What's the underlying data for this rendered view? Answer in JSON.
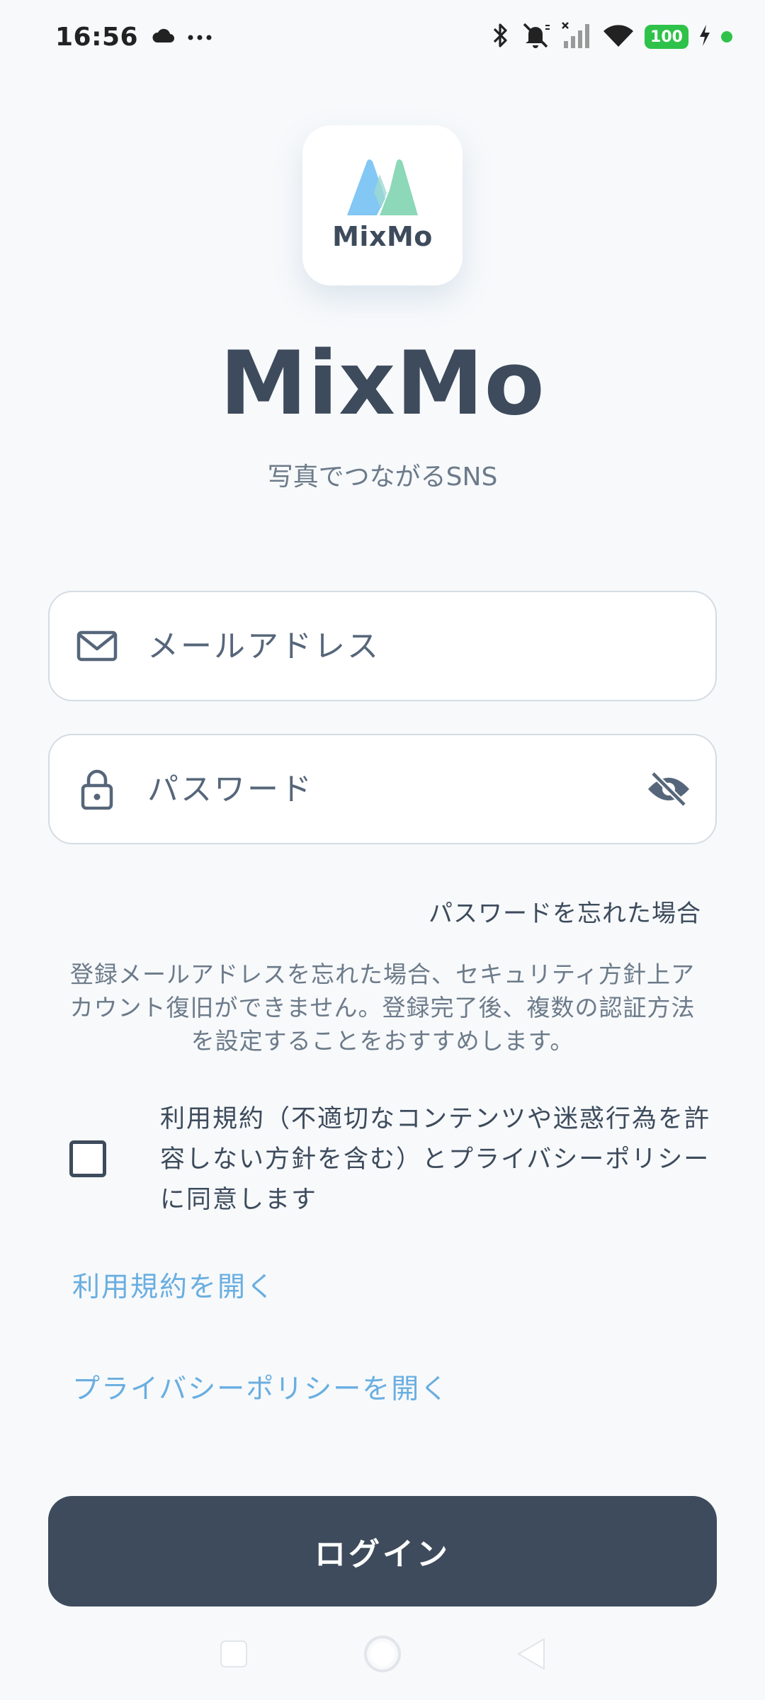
{
  "status_bar": {
    "time": "16:56",
    "battery": "100",
    "icons": [
      "cloud-icon",
      "more-icon",
      "bluetooth-icon",
      "bell-off-icon",
      "signal-icon",
      "wifi-icon",
      "battery-icon",
      "charging-icon"
    ]
  },
  "app": {
    "logo_text": "MixMo",
    "title": "MixMo",
    "subtitle": "写真でつながるSNS"
  },
  "form": {
    "email_placeholder": "メールアドレス",
    "password_placeholder": "パスワード",
    "forgot_password": "パスワードを忘れた場合",
    "notice": "登録メールアドレスを忘れた場合、セキュリティ方針上アカウント復旧ができません。登録完了後、複数の認証方法を設定することをおすすめします。",
    "agree_text": "利用規約（不適切なコンテンツや迷惑行為を許容しない方針を含む）とプライバシーポリシーに同意します",
    "agree_checked": false,
    "terms_link": "利用規約を開く",
    "privacy_link": "プライバシーポリシーを開く",
    "login_button": "ログイン"
  },
  "colors": {
    "primary": "#3d4b5c",
    "link": "#6aaee0",
    "background": "#f7f9fb",
    "logo_blue": "#7cc4f4",
    "logo_green": "#86d6b4"
  }
}
